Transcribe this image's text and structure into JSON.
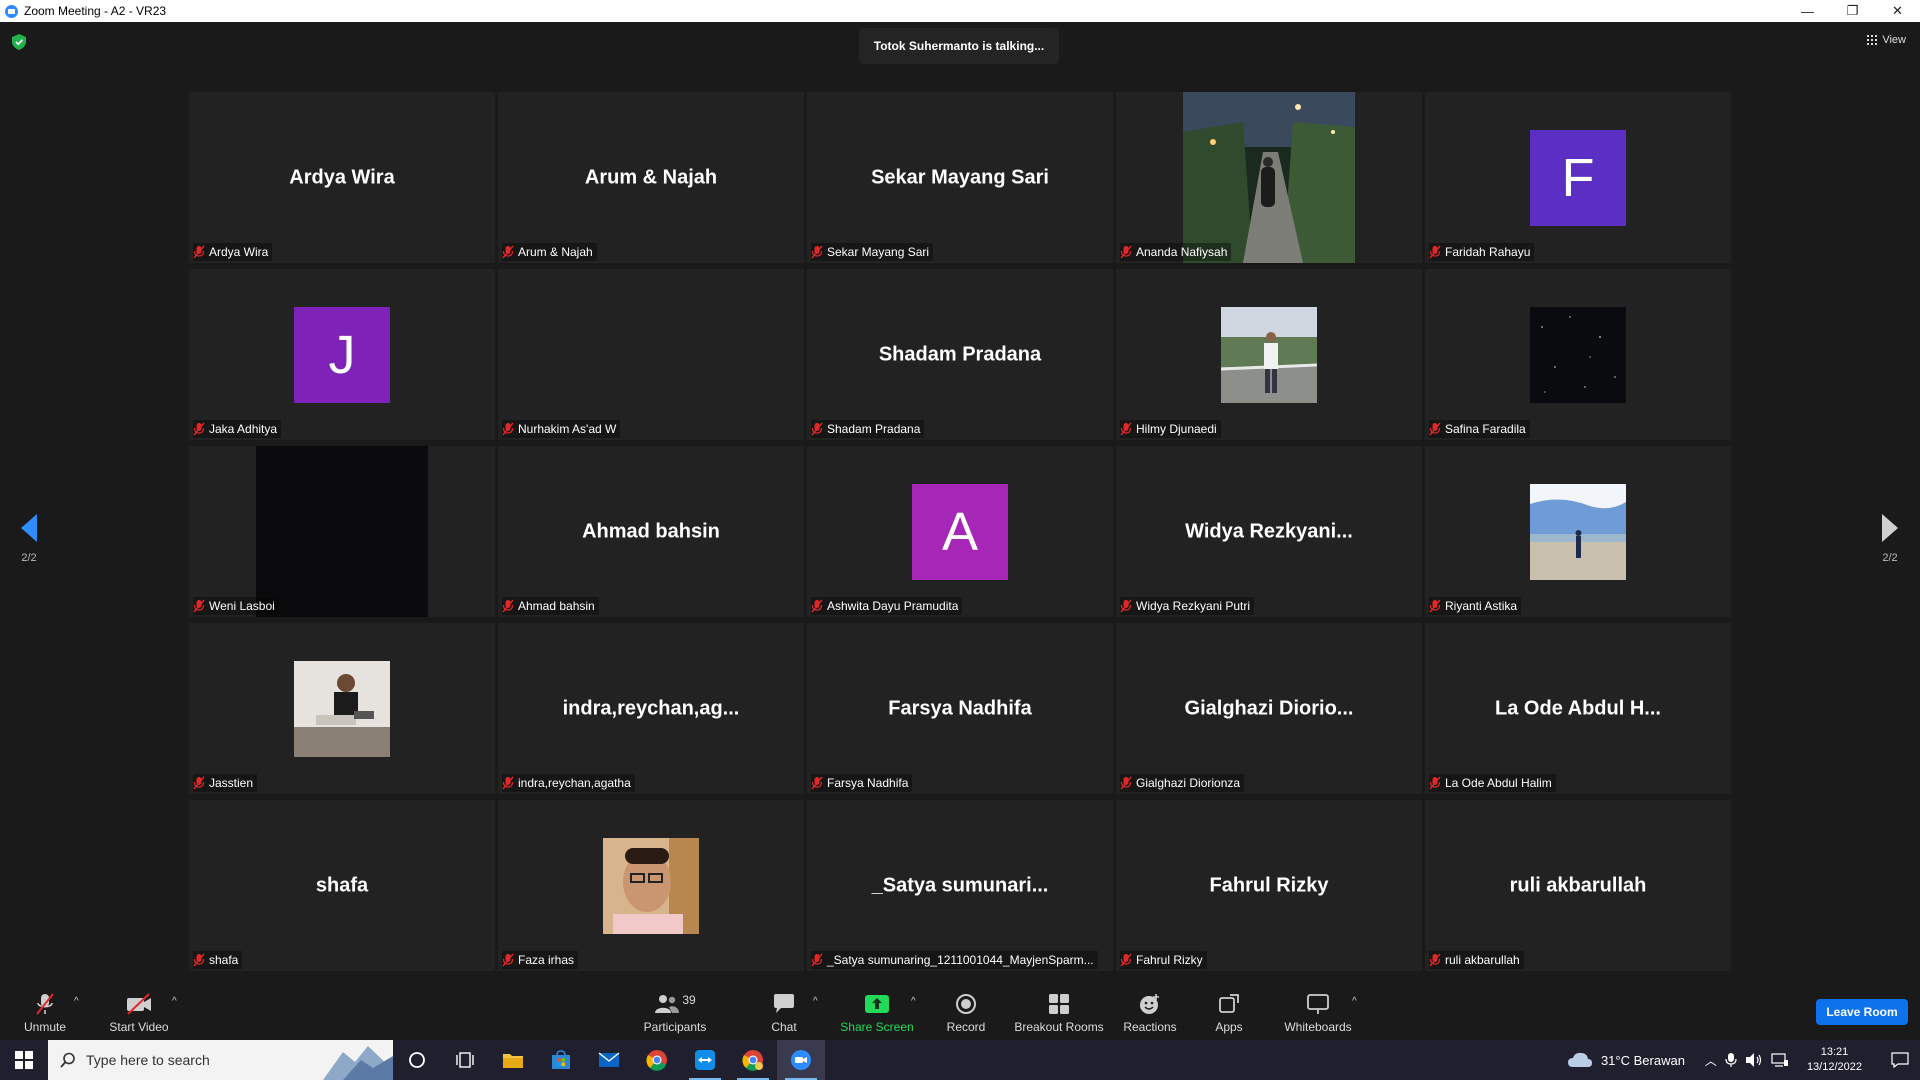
{
  "window": {
    "title": "Zoom Meeting - A2 - VR23",
    "minimize": "—",
    "restore": "❐",
    "close": "✕"
  },
  "meeting": {
    "talking_banner": "Totok Suhermanto is talking...",
    "view_label": "View",
    "page_left": "2/2",
    "page_right": "2/2"
  },
  "participants": [
    {
      "display": "Ardya Wira",
      "label": "Ardya Wira",
      "kind": "name"
    },
    {
      "display": "Arum & Najah",
      "label": "Arum & Najah",
      "kind": "name"
    },
    {
      "display": "Sekar Mayang Sari",
      "label": "Sekar Mayang Sari",
      "kind": "name"
    },
    {
      "display": "",
      "label": "Ananda Nafiysah",
      "kind": "video-night"
    },
    {
      "display": "F",
      "label": "Faridah Rahayu",
      "kind": "letter",
      "color": "#5b2fc4"
    },
    {
      "display": "J",
      "label": "Jaka Adhitya",
      "kind": "letter",
      "color": "#7e22b8"
    },
    {
      "display": "",
      "label": "Nurhakim As'ad W",
      "kind": "blank"
    },
    {
      "display": "Shadam Pradana",
      "label": "Shadam Pradana",
      "kind": "name"
    },
    {
      "display": "",
      "label": "Hilmy Djunaedi",
      "kind": "photo-outdoor"
    },
    {
      "display": "",
      "label": "Safina Faradila",
      "kind": "photo-stars"
    },
    {
      "display": "",
      "label": "Weni Lasboi",
      "kind": "video-dark"
    },
    {
      "display": "Ahmad bahsin",
      "label": "Ahmad bahsin",
      "kind": "name"
    },
    {
      "display": "A",
      "label": "Ashwita Dayu Pramudita",
      "kind": "letter",
      "color": "#a626b8"
    },
    {
      "display": "Widya  Rezkyani...",
      "label": "Widya Rezkyani Putri",
      "kind": "name"
    },
    {
      "display": "",
      "label": "Riyanti Astika",
      "kind": "photo-beach"
    },
    {
      "display": "",
      "label": "Jasstien",
      "kind": "photo-room"
    },
    {
      "display": "indra,reychan,ag...",
      "label": "indra,reychan,agatha",
      "kind": "name"
    },
    {
      "display": "Farsya Nadhifa",
      "label": "Farsya Nadhifa",
      "kind": "name"
    },
    {
      "display": "Gialghazi  Diorio...",
      "label": "Gialghazi Diorionza",
      "kind": "name"
    },
    {
      "display": "La Ode Abdul H...",
      "label": "La Ode Abdul Halim",
      "kind": "name"
    },
    {
      "display": "shafa",
      "label": "shafa",
      "kind": "name"
    },
    {
      "display": "",
      "label": "Faza irhas",
      "kind": "photo-face"
    },
    {
      "display": "_Satya  sumunari...",
      "label": "_Satya sumunaring_1211001044_MayjenSparm...",
      "kind": "name"
    },
    {
      "display": "Fahrul Rizky",
      "label": "Fahrul Rizky",
      "kind": "name"
    },
    {
      "display": "ruli akbarullah",
      "label": "ruli akbarullah",
      "kind": "name"
    }
  ],
  "toolbar": {
    "unmute": "Unmute",
    "start_video": "Start Video",
    "participants": "Participants",
    "participants_count": "39",
    "chat": "Chat",
    "share_screen": "Share Screen",
    "record": "Record",
    "breakout_rooms": "Breakout Rooms",
    "reactions": "Reactions",
    "apps": "Apps",
    "whiteboards": "Whiteboards",
    "leave_room": "Leave Room",
    "share_color": "#23d959"
  },
  "taskbar": {
    "search_placeholder": "Type here to search",
    "weather": "31°C  Berawan",
    "time": "13:21",
    "date": "13/12/2022"
  }
}
